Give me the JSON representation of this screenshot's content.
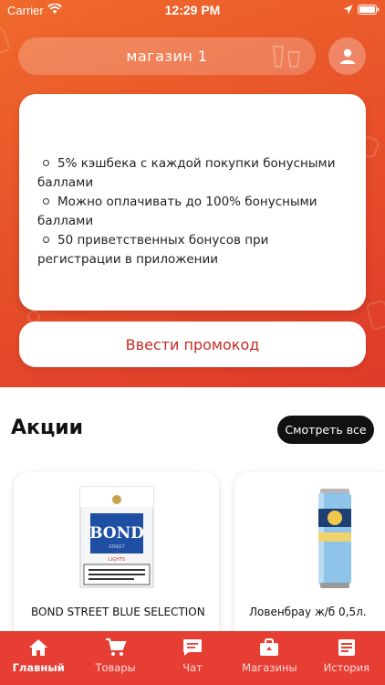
{
  "status_bar": {
    "carrier": "Carrier",
    "time": "12:29 PM"
  },
  "header": {
    "store_name": "магазин 1"
  },
  "info_card": {
    "items": [
      "5% кэшбека с каждой покупки бонусными баллами",
      "Можно оплачивать до 100% бонусными баллами",
      "50 приветственных бонусов при регистрации в приложении"
    ]
  },
  "promo_button": {
    "label": "Ввести промокод"
  },
  "promotions": {
    "title": "Акции",
    "see_all_label": "Смотреть все",
    "products": [
      {
        "name": "BOND STREET BLUE SELECTION",
        "image": "cigarette-pack"
      },
      {
        "name": "Ловенбрау ж/б 0,5л.",
        "image": "beer-can"
      }
    ]
  },
  "tabbar": {
    "tabs": [
      {
        "label": "Главный",
        "icon": "home-icon",
        "active": true
      },
      {
        "label": "Товары",
        "icon": "cart-icon",
        "active": false
      },
      {
        "label": "Чат",
        "icon": "chat-icon",
        "active": false
      },
      {
        "label": "Магазины",
        "icon": "store-icon",
        "active": false
      },
      {
        "label": "История",
        "icon": "history-icon",
        "active": false
      }
    ]
  },
  "colors": {
    "accent": "#e63e33",
    "hero_gradient_start": "#ef6a2c",
    "hero_gradient_end": "#de3a2a",
    "promo_text": "#c62a22"
  }
}
